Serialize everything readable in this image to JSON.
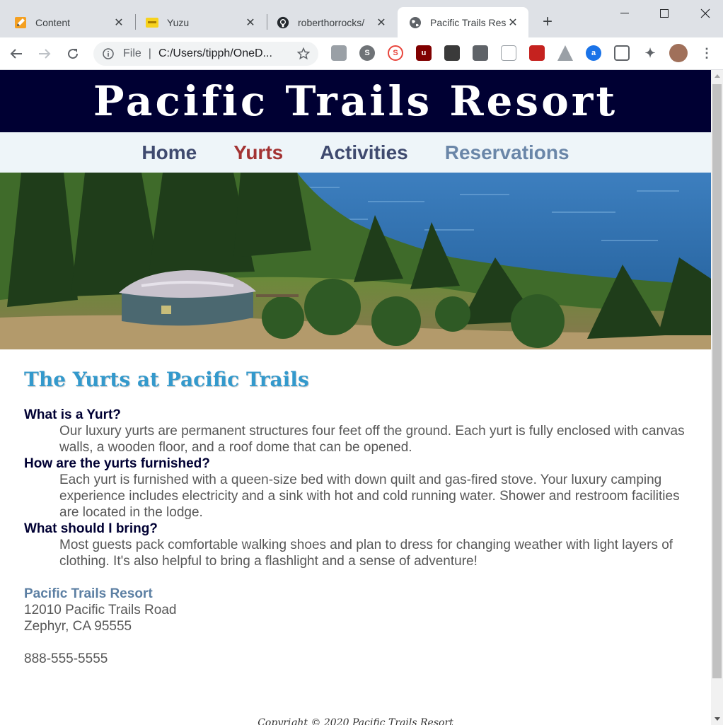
{
  "browser": {
    "tabs": [
      {
        "title": "Content",
        "icon": "pencil-icon",
        "active": false
      },
      {
        "title": "Yuzu",
        "icon": "yuzu-icon",
        "active": false
      },
      {
        "title": "roberthorrocks/",
        "icon": "github-icon",
        "active": false
      },
      {
        "title": "Pacific Trails Res",
        "icon": "globe-icon",
        "active": true
      }
    ],
    "omnibox": {
      "scheme": "File",
      "url": "C:/Users/tipph/OneD..."
    },
    "colors": {
      "tabstrip": "#dee1e6",
      "toolbar": "#ffffff"
    }
  },
  "site": {
    "title": "Pacific Trails Resort",
    "nav": [
      "Home",
      "Yurts",
      "Activities",
      "Reservations"
    ],
    "colors": {
      "header_bg": "#000033",
      "nav_bg": "#eef5f9",
      "heading": "#3399cc",
      "current_nav": "#a33333"
    }
  },
  "main": {
    "heading": "The Yurts at Pacific Trails",
    "faq": [
      {
        "q": "What is a Yurt?",
        "a": "Our luxury yurts are permanent structures four feet off the ground. Each yurt is fully enclosed with canvas walls, a wooden floor, and a roof dome that can be opened."
      },
      {
        "q": "How are the yurts furnished?",
        "a": "Each yurt is furnished with a queen-size bed with down quilt and gas-fired stove. Your luxury camping experience includes electricity and a sink with hot and cold running water. Shower and restroom facilities are located in the lodge."
      },
      {
        "q": "What should I bring?",
        "a": "Most guests pack comfortable walking shoes and plan to dress for changing weather with light layers of clothing. It's also helpful to bring a flashlight and a sense of adventure!"
      }
    ],
    "contact": {
      "company": "Pacific Trails Resort",
      "street": "12010 Pacific Trails Road",
      "city": "Zephyr, CA 95555",
      "phone": "888-555-5555"
    }
  },
  "footer": {
    "copyright": "Copyright © 2020 Pacific Trails Resort"
  }
}
